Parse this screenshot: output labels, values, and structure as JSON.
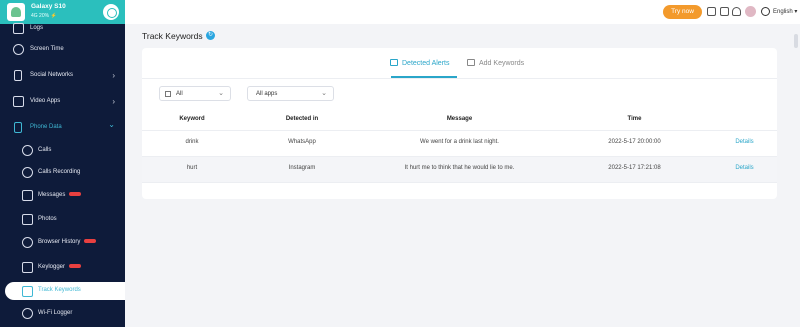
{
  "device": {
    "name": "Galaxy S10",
    "meta": "4G  20%  ⚡"
  },
  "sidebar": {
    "items": [
      {
        "label": "Logs",
        "icon": "log-icon"
      },
      {
        "label": "Screen Time",
        "icon": "screen-time-icon"
      },
      {
        "label": "Social Networks",
        "icon": "social-networks-icon"
      },
      {
        "label": "Video Apps",
        "icon": "video-apps-icon"
      },
      {
        "label": "Phone Data",
        "icon": "phone-data-icon"
      },
      {
        "label": "Calls",
        "icon": "phone-icon"
      },
      {
        "label": "Calls Recording",
        "icon": "microphone-icon"
      },
      {
        "label": "Messages",
        "icon": "message-icon"
      },
      {
        "label": "Photos",
        "icon": "photo-icon"
      },
      {
        "label": "Browser History",
        "icon": "browser-icon"
      },
      {
        "label": "Keylogger",
        "icon": "keyboard-icon"
      },
      {
        "label": "Track Keywords",
        "icon": "keywords-icon"
      },
      {
        "label": "Wi-Fi Logger",
        "icon": "wifi-icon"
      }
    ],
    "chevron_right": "›",
    "chevron_down": "⌄"
  },
  "topbar": {
    "try_now": "Try now",
    "language": "English ▾"
  },
  "page": {
    "title": "Track Keywords",
    "refresh_glyph": "↻"
  },
  "tabs": {
    "detected": "Detected Alerts",
    "add": "Add Keywords"
  },
  "filters": {
    "all": "All",
    "apps": "All apps",
    "caret": "⌄"
  },
  "table": {
    "headers": {
      "keyword": "Keyword",
      "detected_in": "Detected in",
      "message": "Message",
      "time": "Time"
    },
    "rows": [
      {
        "keyword": "drink",
        "detected_in": "WhatsApp",
        "message": "We went for a drink last night.",
        "time": "2022-5-17 20:00:00",
        "details": "Details"
      },
      {
        "keyword": "hurt",
        "detected_in": "Instagram",
        "message": "It hurt me to think that he would lie to me.",
        "time": "2022-5-17 17:21:08",
        "details": "Details"
      }
    ]
  },
  "colors": {
    "sidebar_bg": "#0e1b3a",
    "accent": "#2aa6c9",
    "try_now": "#f39a2c",
    "device_header": "#2bbfbd"
  }
}
